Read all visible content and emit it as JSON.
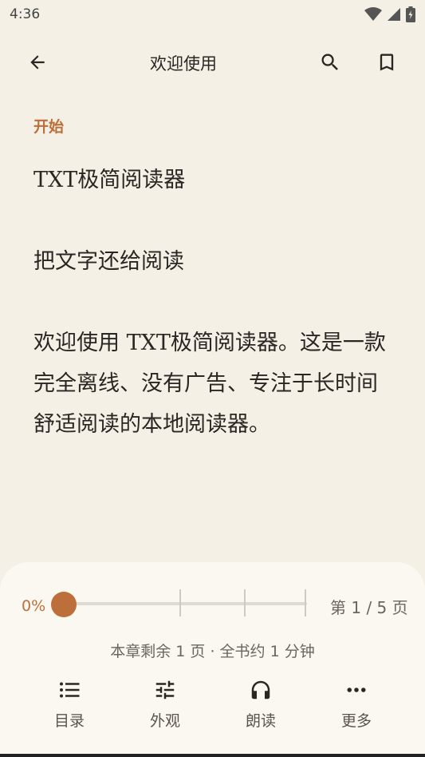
{
  "status_bar": {
    "time": "4:36"
  },
  "header": {
    "title": "欢迎使用"
  },
  "chapter": {
    "label": "开始"
  },
  "content": {
    "paragraphs": [
      "TXT极简阅读器",
      "把文字还给阅读",
      "欢迎使用 TXT极简阅读器。这是一款完全离线、没有广告、专注于长时间舒适阅读的本地阅读器。"
    ]
  },
  "reader_controls": {
    "progress_percent": "0%",
    "progress_value": 0,
    "page_indicator": "第 1 / 5 页",
    "remaining": "本章剩余 1 页 · 全书约 1 分钟",
    "accent_color": "#bc6f3a",
    "nav": [
      {
        "label": "目录",
        "icon": "list-icon"
      },
      {
        "label": "外观",
        "icon": "sliders-icon"
      },
      {
        "label": "朗读",
        "icon": "headphones-icon"
      },
      {
        "label": "更多",
        "icon": "more-horizontal-icon"
      }
    ]
  }
}
